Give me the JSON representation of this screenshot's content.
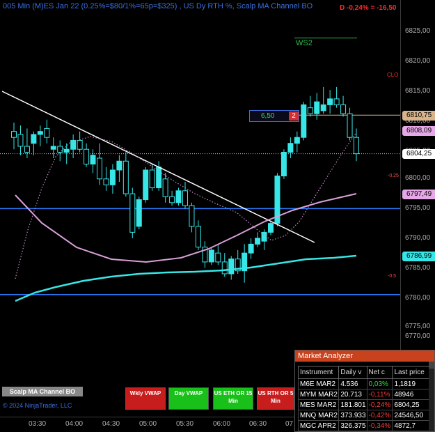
{
  "header": {
    "title": "005 Min (M)ES Jan 22 (0.25%=$80/1%=65p=$325) , US Dy RTH %, Scalp MA Channel BO",
    "pnl": "D -0,24% = -16,50"
  },
  "annotations": {
    "ws2": "WS2",
    "clo": "CLO",
    "pct_neg025": "-0.25",
    "pct_neg05": "-0.5"
  },
  "order": {
    "qty": "6,50",
    "badge": "2"
  },
  "price_axis": {
    "labels": [
      "6825,00",
      "6820,00",
      "6815,00",
      "6810,00",
      "6805,00",
      "6800,00",
      "6795,00",
      "6790,00",
      "6785,00",
      "6780,00",
      "6775,00",
      "6770,00"
    ],
    "tags": [
      {
        "text": "6810,75",
        "color": "#d9b48a"
      },
      {
        "text": "6808,09",
        "color": "#e6a8e6"
      },
      {
        "text": "6804,25",
        "color": "#ffffff"
      },
      {
        "text": "6797,49",
        "color": "#e6a8e6"
      },
      {
        "text": "6786,99",
        "color": "#37e6e6"
      }
    ]
  },
  "time_axis": {
    "labels": [
      "03:30",
      "04:00",
      "04:30",
      "05:00",
      "05:30",
      "06:00",
      "06:30",
      "07"
    ]
  },
  "panel": {
    "label": "Scalp MA Channel BO",
    "copyright": "© 2024 NinjaTrader, LLC"
  },
  "buttons": [
    {
      "label": "Wkly VWAP",
      "color": "#c81d1d"
    },
    {
      "label": "Day VWAP",
      "color": "#19c019"
    },
    {
      "label": "US ETH OR 15 Min",
      "color": "#19c019"
    },
    {
      "label": "US RTH OR 5 Min",
      "color": "#c81d1d"
    }
  ],
  "market_analyzer": {
    "title": "Market Analyzer",
    "columns": [
      "Instrument",
      "Daily v",
      "Net c",
      "Last price"
    ],
    "rows": [
      {
        "instrument": "M6E MAR2",
        "daily": "4.536",
        "net": "0,03%",
        "net_color": "#2fdf2f",
        "last": "1,1819"
      },
      {
        "instrument": "MYM MAR2",
        "daily": "20.713",
        "net": "-0,11%",
        "net_color": "#ff3a3a",
        "last": "48946"
      },
      {
        "instrument": "MES MAR2",
        "daily": "181.801",
        "net": "-0,24%",
        "net_color": "#ff3a3a",
        "last": "6804,25"
      },
      {
        "instrument": "MNQ MAR2",
        "daily": "373.933",
        "net": "-0,42%",
        "net_color": "#ff3a3a",
        "last": "24546,50"
      },
      {
        "instrument": "MGC APR2",
        "daily": "326.375",
        "net": "-0,34%",
        "net_color": "#ff3a3a",
        "last": "4872,7"
      }
    ]
  },
  "chart_data": {
    "type": "candlestick",
    "ylim": [
      6770,
      6830
    ],
    "levels": [
      6795.0,
      6780.5,
      6804.25,
      6810.75
    ],
    "candles": [
      [
        6808.0,
        6809.5,
        6805.0,
        6807.0
      ],
      [
        6807.5,
        6809.0,
        6804.0,
        6805.5
      ],
      [
        6805.5,
        6808.5,
        6803.5,
        6804.5
      ],
      [
        6806.0,
        6808.0,
        6804.0,
        6807.5
      ],
      [
        6807.5,
        6809.0,
        6805.5,
        6808.0
      ],
      [
        6808.5,
        6810.0,
        6806.0,
        6807.0
      ],
      [
        6805.0,
        6807.0,
        6803.5,
        6805.5
      ],
      [
        6805.5,
        6806.5,
        6803.0,
        6804.5
      ],
      [
        6804.5,
        6806.0,
        6802.5,
        6805.0
      ],
      [
        6805.0,
        6807.5,
        6803.5,
        6806.5
      ],
      [
        6806.5,
        6808.0,
        6804.5,
        6805.0
      ],
      [
        6805.0,
        6806.0,
        6802.0,
        6802.5
      ],
      [
        6802.5,
        6805.0,
        6801.0,
        6804.0
      ],
      [
        6803.5,
        6806.0,
        6799.0,
        6800.0
      ],
      [
        6800.0,
        6802.0,
        6798.0,
        6799.0
      ],
      [
        6799.0,
        6802.5,
        6797.5,
        6801.5
      ],
      [
        6801.5,
        6804.0,
        6799.5,
        6803.0
      ],
      [
        6803.0,
        6804.5,
        6797.0,
        6797.5
      ],
      [
        6797.5,
        6798.5,
        6790.0,
        6791.0
      ],
      [
        6792.0,
        6797.0,
        6791.5,
        6796.5
      ],
      [
        6796.5,
        6802.0,
        6796.0,
        6801.5
      ],
      [
        6801.5,
        6802.5,
        6798.0,
        6798.5
      ],
      [
        6798.5,
        6803.0,
        6798.0,
        6802.0
      ],
      [
        6800.0,
        6801.0,
        6796.0,
        6797.0
      ],
      [
        6797.0,
        6798.0,
        6795.5,
        6796.0
      ],
      [
        6796.0,
        6798.5,
        6795.5,
        6798.0
      ],
      [
        6798.0,
        6799.5,
        6795.0,
        6795.5
      ],
      [
        6795.5,
        6796.0,
        6791.0,
        6792.0
      ],
      [
        6792.0,
        6793.0,
        6788.0,
        6788.5
      ],
      [
        6788.5,
        6789.5,
        6785.0,
        6786.0
      ],
      [
        6786.0,
        6788.5,
        6785.5,
        6788.0
      ],
      [
        6787.5,
        6789.0,
        6785.5,
        6786.0
      ],
      [
        6786.0,
        6787.5,
        6783.5,
        6784.0
      ],
      [
        6784.0,
        6787.0,
        6783.0,
        6786.5
      ],
      [
        6786.5,
        6788.0,
        6784.0,
        6784.5
      ],
      [
        6784.5,
        6789.0,
        6782.5,
        6787.5
      ],
      [
        6787.5,
        6790.0,
        6786.5,
        6789.0
      ],
      [
        6789.0,
        6791.0,
        6788.5,
        6790.0
      ],
      [
        6789.5,
        6791.5,
        6788.0,
        6791.0
      ],
      [
        6791.0,
        6793.0,
        6790.5,
        6792.5
      ],
      [
        6792.5,
        6801.0,
        6792.0,
        6800.5
      ],
      [
        6800.5,
        6805.0,
        6800.0,
        6804.5
      ],
      [
        6804.5,
        6807.0,
        6803.5,
        6806.0
      ],
      [
        6806.0,
        6808.0,
        6804.5,
        6807.0
      ],
      [
        6807.0,
        6813.0,
        6806.5,
        6812.5
      ],
      [
        6812.0,
        6814.0,
        6810.5,
        6811.0
      ],
      [
        6811.0,
        6814.5,
        6810.0,
        6813.0
      ],
      [
        6811.5,
        6815.5,
        6811.0,
        6812.5
      ],
      [
        6812.5,
        6815.0,
        6811.0,
        6813.5
      ],
      [
        6813.5,
        6815.5,
        6812.0,
        6812.5
      ],
      [
        6812.5,
        6814.0,
        6810.5,
        6811.0
      ],
      [
        6811.0,
        6812.0,
        6806.5,
        6807.0
      ],
      [
        6807.0,
        6808.5,
        6803.0,
        6804.25
      ]
    ]
  }
}
